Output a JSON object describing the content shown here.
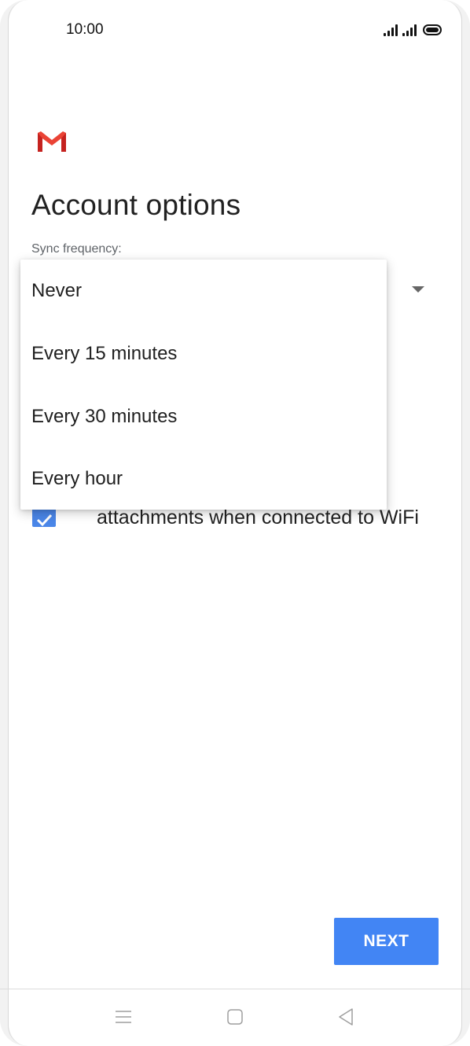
{
  "status_bar": {
    "time": "10:00",
    "icons": [
      "signal-sim1-icon",
      "signal-sim2-icon",
      "battery-icon"
    ]
  },
  "header": {
    "logo": "gmail-logo-icon",
    "title": "Account options"
  },
  "sync": {
    "label": "Sync frequency:",
    "options": [
      {
        "label": "Never"
      },
      {
        "label": "Every 15 minutes"
      },
      {
        "label": "Every 30 minutes"
      },
      {
        "label": "Every hour"
      }
    ]
  },
  "attachments": {
    "checked": true,
    "label_visible": "attachments when connected to WiFi"
  },
  "actions": {
    "next_label": "NEXT"
  },
  "colors": {
    "accent": "#4285f4",
    "checkbox": "#4a86e8",
    "gmail_red": "#ea4335"
  },
  "nav_bar": {
    "icons": [
      "menu-icon",
      "home-icon",
      "back-icon"
    ]
  }
}
